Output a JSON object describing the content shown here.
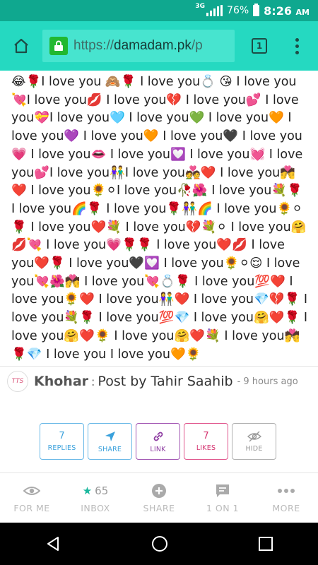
{
  "status_bar": {
    "network": "3G",
    "battery": "76%",
    "time": "8:26",
    "ampm": "AM"
  },
  "browser": {
    "url_scheme": "https://",
    "url_host": "damadam.pk",
    "url_rest": "/p",
    "tab_count": "1"
  },
  "post": {
    "text": "😂🌹I love you 🙈🌹 I love you💍 😘 I love you💘I love you💋 I love you💔 I love you💕 I love you💝I love you🩵 I love you💚 I love you🧡 I love you💜 I love you🧡 I love you🖤 I love you💗 I love you👄 I love you💟 I love you💓 I love you💕I love you👫I love you💑❤️ I love you💏❤️ I love you🌻⚪I love you🥀🌺 I love you💐🌹 I love you🌈🌹 I love you🌹👫🌈 I love you🌻⚪🌹 I love you❤️💐 I love you💔💐⚪ I love you🤗💋💘 I love you💗🌹🌹 I love you❤️💋 I love you❤️🌹 I love you🖤💟 I love you🌻⚪😌 I love you💘🌺💏 I love you💘💍🌹 I love you💯❤️ I love you🌻❤️ I love you👫❤️ I love you💎💔🌹 I love you💐🌹 I love you💯💎 I love you🤗❤️🌹 I love you🤗❤️🌻 I love you🤗❤️💐 I love you💏🌹💎 I love you I love you🧡🌻",
    "author": "Khohar",
    "separator": ":",
    "title": "Post by Tahir Saahib",
    "time_ago": "- 9 hours ago",
    "avatar_text": "TTS"
  },
  "actions": [
    {
      "count": "7",
      "label": "REPLIES"
    },
    {
      "label": "SHARE"
    },
    {
      "label": "LINK"
    },
    {
      "count": "7",
      "label": "LIKES"
    },
    {
      "label": "HIDE"
    }
  ],
  "bottom_nav": [
    {
      "label": "FOR ME",
      "icon": "eye-icon"
    },
    {
      "label": "INBOX",
      "icon": "star-icon",
      "count": "65"
    },
    {
      "label": "SHARE",
      "icon": "plus-circle-icon"
    },
    {
      "label": "1 ON 1",
      "icon": "chat-icon"
    },
    {
      "label": "MORE",
      "icon": "more-dots-icon"
    }
  ],
  "colors": {
    "status_bar": "#0fa88f",
    "url_bar": "#25d9c1",
    "accent": "#19b79d"
  }
}
